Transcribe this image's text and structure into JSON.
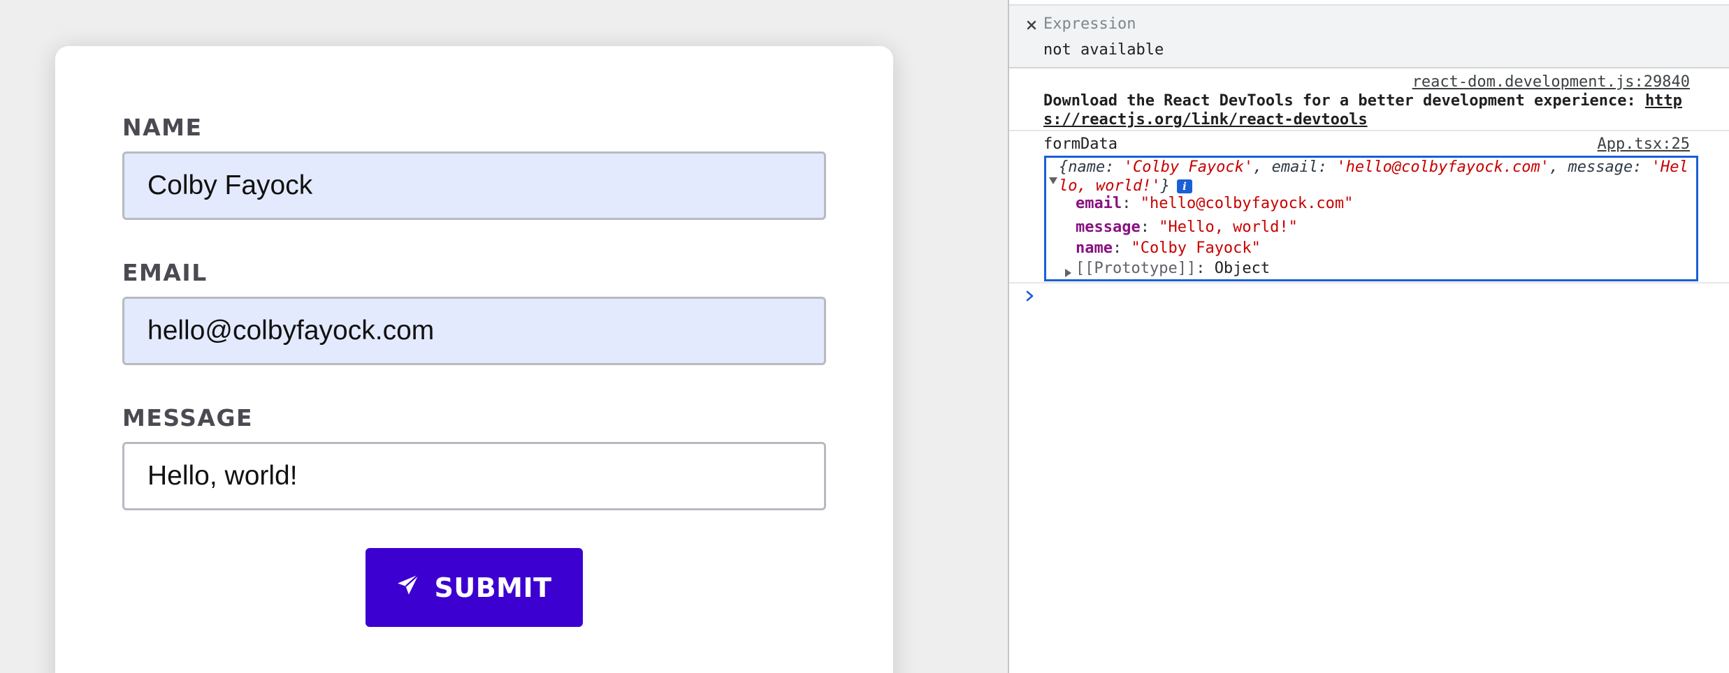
{
  "form": {
    "fields": [
      {
        "label": "NAME",
        "value": "Colby Fayock"
      },
      {
        "label": "EMAIL",
        "value": "hello@colbyfayock.com"
      },
      {
        "label": "MESSAGE",
        "value": "Hello, world!"
      }
    ],
    "submit_label": "SUBMIT",
    "colors": {
      "button": "#3c00d0",
      "autofill": "#e3eafd"
    }
  },
  "devtools": {
    "expression": {
      "title": "Expression",
      "value": "not available"
    },
    "messages": [
      {
        "source": "react-dom.development.js:29840",
        "text_prefix": "Download the React DevTools for a better development experience: ",
        "link": "https://reactjs.org/link/react-devtools"
      },
      {
        "label": "formData",
        "source": "App.tsx:25",
        "object": {
          "preview": {
            "open": "{",
            "k1": "name: ",
            "v1": "'Colby Fayock'",
            "k2": ", email: ",
            "v2": "'hello@colbyfayock.com'",
            "k3": ", message: ",
            "v3": "'Hello, world!'",
            "close": "}"
          },
          "info_badge": "i",
          "properties": [
            {
              "key": "email",
              "value": "\"hello@colbyfayock.com\""
            },
            {
              "key": "message",
              "value": "\"Hello, world!\""
            },
            {
              "key": "name",
              "value": "\"Colby Fayock\""
            }
          ],
          "prototype": {
            "key": "[[Prototype]]",
            "value": "Object"
          }
        }
      }
    ],
    "colors": {
      "highlight": "#1a5fd6",
      "string": "#c80000",
      "property": "#881280"
    }
  }
}
